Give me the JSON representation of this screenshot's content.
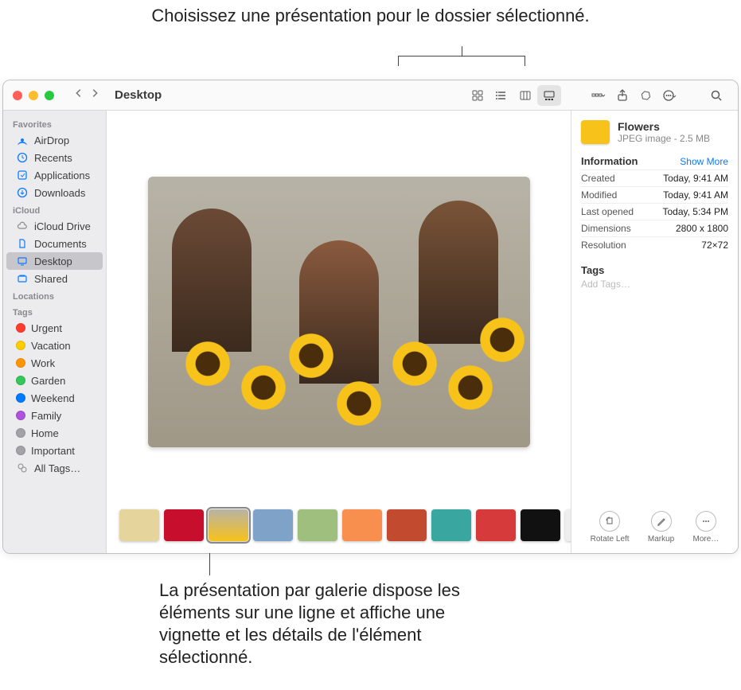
{
  "annotations": {
    "top": "Choisissez une présentation pour le dossier sélectionné.",
    "bottom": "La présentation par galerie dispose les éléments sur une ligne et affiche une vignette et les détails de l'élément sélectionné."
  },
  "window": {
    "title": "Desktop"
  },
  "sidebar": {
    "sections": [
      {
        "header": "Favorites",
        "items": [
          {
            "label": "AirDrop",
            "icon": "airdrop"
          },
          {
            "label": "Recents",
            "icon": "clock"
          },
          {
            "label": "Applications",
            "icon": "app"
          },
          {
            "label": "Downloads",
            "icon": "download"
          }
        ]
      },
      {
        "header": "iCloud",
        "items": [
          {
            "label": "iCloud Drive",
            "icon": "cloud"
          },
          {
            "label": "Documents",
            "icon": "doc"
          },
          {
            "label": "Desktop",
            "icon": "desktop",
            "selected": true
          },
          {
            "label": "Shared",
            "icon": "shared"
          }
        ]
      },
      {
        "header": "Locations",
        "items": []
      },
      {
        "header": "Tags",
        "items": [
          {
            "label": "Urgent",
            "color": "#ff3b30"
          },
          {
            "label": "Vacation",
            "color": "#ffcc00"
          },
          {
            "label": "Work",
            "color": "#ff9500"
          },
          {
            "label": "Garden",
            "color": "#34c759"
          },
          {
            "label": "Weekend",
            "color": "#007aff"
          },
          {
            "label": "Family",
            "color": "#af52de"
          },
          {
            "label": "Home",
            "color": "#a2a2a7"
          },
          {
            "label": "Important",
            "color": "#a2a2a7"
          },
          {
            "label": "All Tags…",
            "icon": "alltags"
          }
        ]
      }
    ]
  },
  "thumbnails": [
    {
      "color": "#e5d49c"
    },
    {
      "color": "#c70e2d"
    },
    {
      "color": "#f7c21a",
      "selected": true
    },
    {
      "color": "#7fa3c8"
    },
    {
      "color": "#9fbf7f"
    },
    {
      "color": "#f88f4e"
    },
    {
      "color": "#c24a2e"
    },
    {
      "color": "#3aa6a0"
    },
    {
      "color": "#d63a3a"
    },
    {
      "color": "#111"
    },
    {
      "color": "#eee"
    }
  ],
  "file": {
    "name": "Flowers",
    "kind_size": "JPEG image - 2.5 MB"
  },
  "info": {
    "section_title": "Information",
    "show_more": "Show More",
    "rows": [
      {
        "k": "Created",
        "v": "Today, 9:41 AM"
      },
      {
        "k": "Modified",
        "v": "Today, 9:41 AM"
      },
      {
        "k": "Last opened",
        "v": "Today, 5:34 PM"
      },
      {
        "k": "Dimensions",
        "v": "2800 x 1800"
      },
      {
        "k": "Resolution",
        "v": "72×72"
      }
    ],
    "tags_title": "Tags",
    "add_tags": "Add Tags…"
  },
  "actions": {
    "rotate": "Rotate Left",
    "markup": "Markup",
    "more": "More…"
  }
}
